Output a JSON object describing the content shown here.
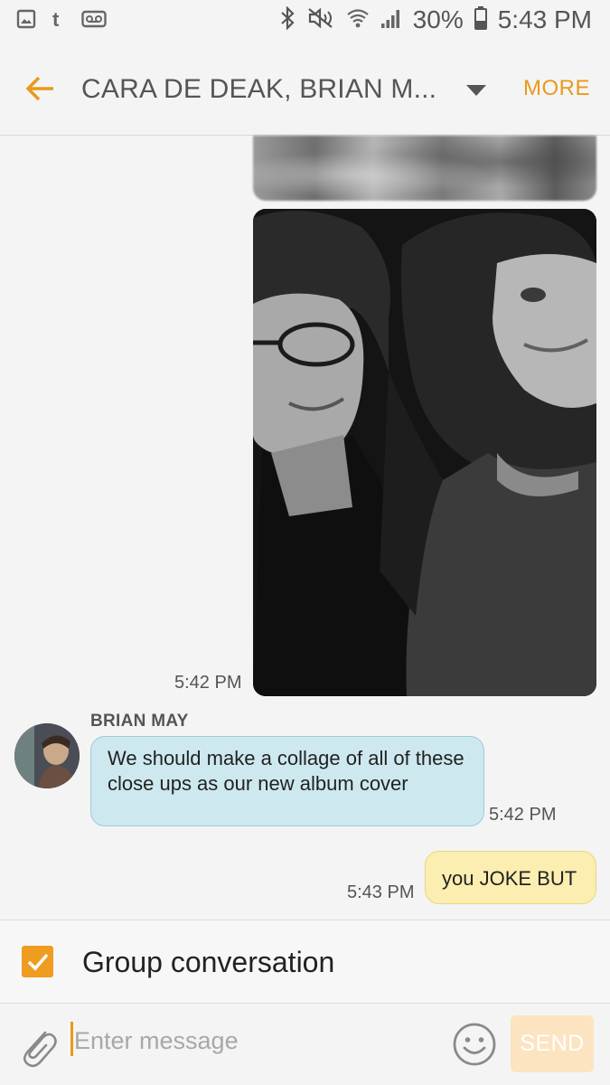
{
  "status_bar": {
    "battery_text": "30%",
    "time": "5:43 PM",
    "left_icons": [
      "gallery-icon",
      "tumblr-icon",
      "voicemail-icon"
    ],
    "right_icons": [
      "bluetooth-icon",
      "mute-icon",
      "wifi-icon",
      "signal-icon",
      "battery-icon"
    ]
  },
  "header": {
    "title": "CARA DE DEAK, BRIAN M...",
    "more_label": "MORE",
    "accent_color": "#e89a1c"
  },
  "messages": [
    {
      "type": "image",
      "direction": "outgoing",
      "content": "blurred-photo"
    },
    {
      "type": "image",
      "direction": "outgoing",
      "content": "photo-two-women",
      "time": "5:42 PM"
    },
    {
      "type": "text",
      "direction": "incoming",
      "sender": "BRIAN MAY",
      "text": "We should make a collage of all of these close ups as our new album cover",
      "time": "5:42 PM"
    },
    {
      "type": "text",
      "direction": "outgoing",
      "text": "you JOKE BUT",
      "time": "5:43 PM"
    }
  ],
  "group_conversation": {
    "label": "Group conversation",
    "checked": true
  },
  "input": {
    "placeholder": "Enter message",
    "send_label": "SEND"
  }
}
